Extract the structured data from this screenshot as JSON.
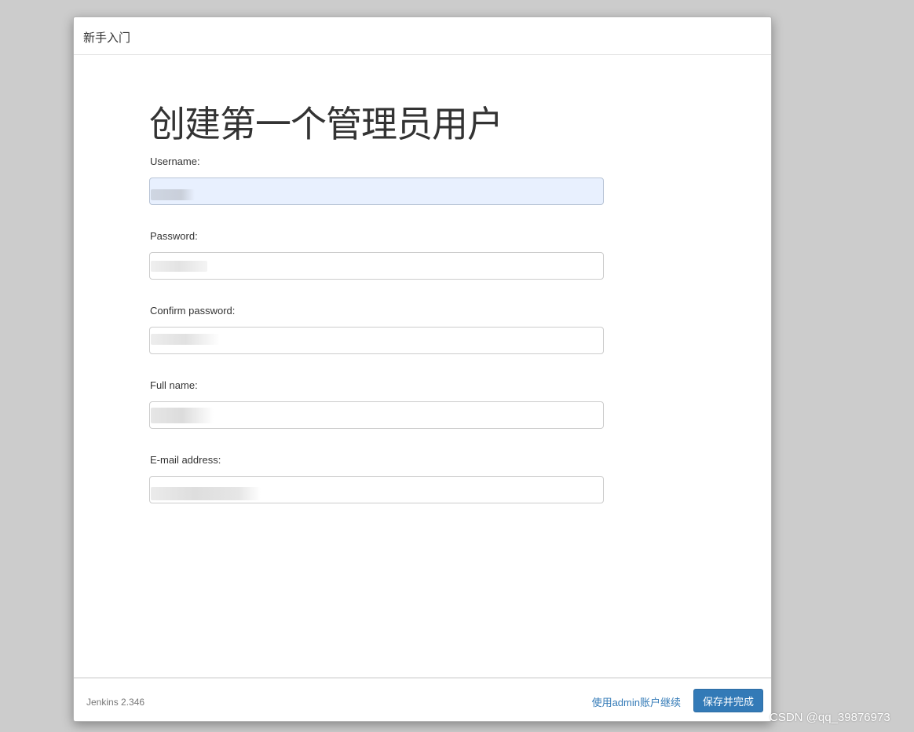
{
  "dialog": {
    "title": "新手入门",
    "heading": "创建第一个管理员用户"
  },
  "form": {
    "fields": [
      {
        "label": "Username:",
        "value": ""
      },
      {
        "label": "Password:",
        "value": ""
      },
      {
        "label": "Confirm password:",
        "value": ""
      },
      {
        "label": "Full name:",
        "value": ""
      },
      {
        "label": "E-mail address:",
        "value": ""
      }
    ]
  },
  "footer": {
    "version": "Jenkins 2.346",
    "skip_link": "使用admin账户继续",
    "save_button": "保存并完成"
  },
  "watermark": "CSDN @qq_39876973",
  "colors": {
    "primary": "#337ab7",
    "autofill_bg": "#e8f0fe",
    "backdrop": "#cccccc"
  }
}
